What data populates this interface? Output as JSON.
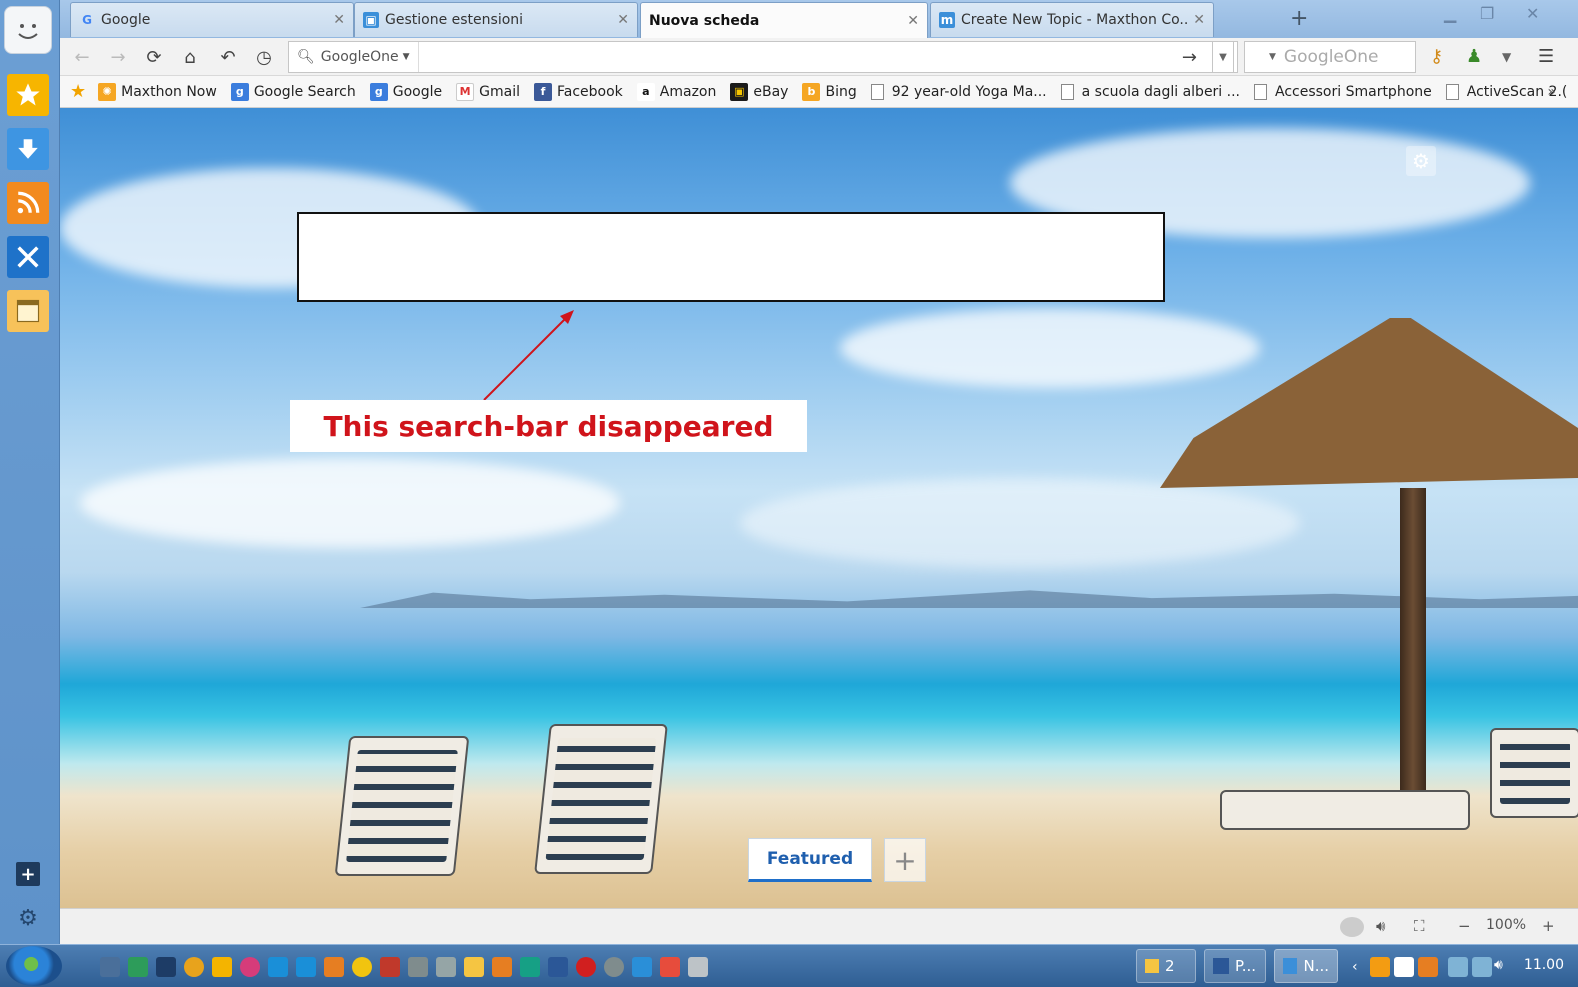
{
  "tabs": [
    {
      "label": "Google",
      "icon": "google-g-icon",
      "active": false
    },
    {
      "label": "Gestione estensioni",
      "icon": "extensions-icon",
      "active": false
    },
    {
      "label": "Nuova scheda",
      "icon": "",
      "active": true
    },
    {
      "label": "Create New Topic - Maxthon Co...",
      "icon": "maxthon-icon",
      "active": false
    }
  ],
  "address_bar": {
    "search_engine": "GoogleOne",
    "url_value": "",
    "search_box_placeholder": "GoogleOne"
  },
  "bookmarks": [
    {
      "label": "Maxthon Now",
      "icon": "maxthon-now-icon"
    },
    {
      "label": "Google Search",
      "icon": "google-search-icon"
    },
    {
      "label": "Google",
      "icon": "google-icon"
    },
    {
      "label": "Gmail",
      "icon": "gmail-icon"
    },
    {
      "label": "Facebook",
      "icon": "facebook-icon"
    },
    {
      "label": "Amazon",
      "icon": "amazon-icon"
    },
    {
      "label": "eBay",
      "icon": "ebay-icon"
    },
    {
      "label": "Bing",
      "icon": "bing-icon"
    },
    {
      "label": "92 year-old Yoga Ma...",
      "icon": "page-icon"
    },
    {
      "label": "a scuola dagli alberi ...",
      "icon": "page-icon"
    },
    {
      "label": "Accessori Smartphone",
      "icon": "page-icon"
    },
    {
      "label": "ActiveScan 2.(",
      "icon": "page-icon"
    }
  ],
  "annotation": {
    "callout_text": "This search-bar disappeared",
    "callout_color": "#d0141b"
  },
  "newtab": {
    "featured_label": "Featured",
    "add_label": "+"
  },
  "statusbar": {
    "zoom": "100%",
    "zoom_minus": "−",
    "zoom_plus": "+"
  },
  "taskbar": {
    "group_count": "2",
    "task_word": "P...",
    "task_maxthon": "N...",
    "clock": "11.00"
  },
  "colors": {
    "accent": "#1f6fc9",
    "sidebar": "#6c9fd4"
  }
}
